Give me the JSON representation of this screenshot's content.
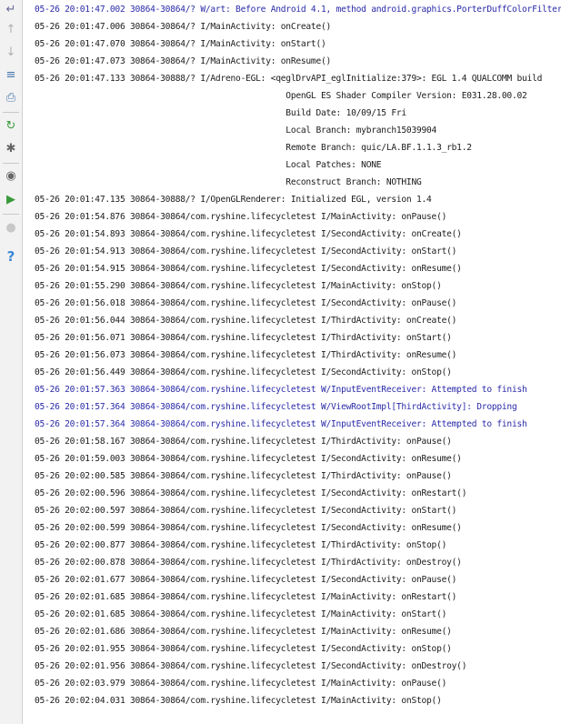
{
  "toolbar": {
    "buttons": [
      {
        "name": "soft-wraps-icon",
        "glyph": "↵",
        "color": "#6a6a9a"
      },
      {
        "name": "scroll-up-icon",
        "glyph": "↑",
        "color": "#b0b0b0"
      },
      {
        "name": "scroll-down-icon",
        "glyph": "↓",
        "color": "#b0b0b0"
      },
      {
        "name": "filter-settings-icon",
        "glyph": "≡",
        "color": "#4a7ab0"
      },
      {
        "name": "print-icon",
        "glyph": "⎙",
        "color": "#4a7ab0"
      },
      {
        "name": "restart-icon",
        "glyph": "↻",
        "color": "#3a9a3a"
      },
      {
        "name": "settings-icon",
        "glyph": "✱",
        "color": "#666666"
      },
      {
        "name": "screen-capture-icon",
        "glyph": "◉",
        "color": "#666666"
      },
      {
        "name": "screen-record-icon",
        "glyph": "▶",
        "color": "#3a9a3a"
      },
      {
        "name": "terminate-icon",
        "glyph": "●",
        "color": "#c8c8c8"
      },
      {
        "name": "help-icon",
        "glyph": "?",
        "color": "#3a88d8"
      }
    ]
  },
  "log": {
    "lines": [
      {
        "text": "05-26 20:01:47.002 30864-30864/? W/art: Before Android 4.1, method android.graphics.PorterDuffColorFilter",
        "level": "warn"
      },
      {
        "text": "05-26 20:01:47.006 30864-30864/? I/MainActivity: onCreate()",
        "level": "info"
      },
      {
        "text": "05-26 20:01:47.070 30864-30864/? I/MainActivity: onStart()",
        "level": "info"
      },
      {
        "text": "05-26 20:01:47.073 30864-30864/? I/MainActivity: onResume()",
        "level": "info"
      },
      {
        "text": "05-26 20:01:47.133 30864-30888/? I/Adreno-EGL: <qeglDrvAPI_eglInitialize:379>: EGL 1.4 QUALCOMM build",
        "level": "info"
      },
      {
        "text": "                                                  OpenGL ES Shader Compiler Version: E031.28.00.02",
        "level": "info"
      },
      {
        "text": "                                                  Build Date: 10/09/15 Fri",
        "level": "info"
      },
      {
        "text": "                                                  Local Branch: mybranch15039904",
        "level": "info"
      },
      {
        "text": "                                                  Remote Branch: quic/LA.BF.1.1.3_rb1.2",
        "level": "info"
      },
      {
        "text": "                                                  Local Patches: NONE",
        "level": "info"
      },
      {
        "text": "                                                  Reconstruct Branch: NOTHING",
        "level": "info"
      },
      {
        "text": "05-26 20:01:47.135 30864-30888/? I/OpenGLRenderer: Initialized EGL, version 1.4",
        "level": "info"
      },
      {
        "text": "05-26 20:01:54.876 30864-30864/com.ryshine.lifecycletest I/MainActivity: onPause()",
        "level": "info"
      },
      {
        "text": "05-26 20:01:54.893 30864-30864/com.ryshine.lifecycletest I/SecondActivity: onCreate()",
        "level": "info"
      },
      {
        "text": "05-26 20:01:54.913 30864-30864/com.ryshine.lifecycletest I/SecondActivity: onStart()",
        "level": "info"
      },
      {
        "text": "05-26 20:01:54.915 30864-30864/com.ryshine.lifecycletest I/SecondActivity: onResume()",
        "level": "info"
      },
      {
        "text": "05-26 20:01:55.290 30864-30864/com.ryshine.lifecycletest I/MainActivity: onStop()",
        "level": "info"
      },
      {
        "text": "05-26 20:01:56.018 30864-30864/com.ryshine.lifecycletest I/SecondActivity: onPause()",
        "level": "info"
      },
      {
        "text": "05-26 20:01:56.044 30864-30864/com.ryshine.lifecycletest I/ThirdActivity: onCreate()",
        "level": "info"
      },
      {
        "text": "05-26 20:01:56.071 30864-30864/com.ryshine.lifecycletest I/ThirdActivity: onStart()",
        "level": "info"
      },
      {
        "text": "05-26 20:01:56.073 30864-30864/com.ryshine.lifecycletest I/ThirdActivity: onResume()",
        "level": "info"
      },
      {
        "text": "05-26 20:01:56.449 30864-30864/com.ryshine.lifecycletest I/SecondActivity: onStop()",
        "level": "info"
      },
      {
        "text": "05-26 20:01:57.363 30864-30864/com.ryshine.lifecycletest W/InputEventReceiver: Attempted to finish",
        "level": "warn"
      },
      {
        "text": "05-26 20:01:57.364 30864-30864/com.ryshine.lifecycletest W/ViewRootImpl[ThirdActivity]: Dropping",
        "level": "warn"
      },
      {
        "text": "05-26 20:01:57.364 30864-30864/com.ryshine.lifecycletest W/InputEventReceiver: Attempted to finish",
        "level": "warn"
      },
      {
        "text": "05-26 20:01:58.167 30864-30864/com.ryshine.lifecycletest I/ThirdActivity: onPause()",
        "level": "info"
      },
      {
        "text": "05-26 20:01:59.003 30864-30864/com.ryshine.lifecycletest I/SecondActivity: onResume()",
        "level": "info"
      },
      {
        "text": "05-26 20:02:00.585 30864-30864/com.ryshine.lifecycletest I/ThirdActivity: onPause()",
        "level": "info"
      },
      {
        "text": "05-26 20:02:00.596 30864-30864/com.ryshine.lifecycletest I/SecondActivity: onRestart()",
        "level": "info"
      },
      {
        "text": "05-26 20:02:00.597 30864-30864/com.ryshine.lifecycletest I/SecondActivity: onStart()",
        "level": "info"
      },
      {
        "text": "05-26 20:02:00.599 30864-30864/com.ryshine.lifecycletest I/SecondActivity: onResume()",
        "level": "info"
      },
      {
        "text": "05-26 20:02:00.877 30864-30864/com.ryshine.lifecycletest I/ThirdActivity: onStop()",
        "level": "info"
      },
      {
        "text": "05-26 20:02:00.878 30864-30864/com.ryshine.lifecycletest I/ThirdActivity: onDestroy()",
        "level": "info"
      },
      {
        "text": "05-26 20:02:01.677 30864-30864/com.ryshine.lifecycletest I/SecondActivity: onPause()",
        "level": "info"
      },
      {
        "text": "05-26 20:02:01.685 30864-30864/com.ryshine.lifecycletest I/MainActivity: onRestart()",
        "level": "info"
      },
      {
        "text": "05-26 20:02:01.685 30864-30864/com.ryshine.lifecycletest I/MainActivity: onStart()",
        "level": "info"
      },
      {
        "text": "05-26 20:02:01.686 30864-30864/com.ryshine.lifecycletest I/MainActivity: onResume()",
        "level": "info"
      },
      {
        "text": "05-26 20:02:01.955 30864-30864/com.ryshine.lifecycletest I/SecondActivity: onStop()",
        "level": "info"
      },
      {
        "text": "05-26 20:02:01.956 30864-30864/com.ryshine.lifecycletest I/SecondActivity: onDestroy()",
        "level": "info"
      },
      {
        "text": "05-26 20:02:03.979 30864-30864/com.ryshine.lifecycletest I/MainActivity: onPause()",
        "level": "info"
      },
      {
        "text": "05-26 20:02:04.031 30864-30864/com.ryshine.lifecycletest I/MainActivity: onStop()",
        "level": "info"
      }
    ]
  }
}
